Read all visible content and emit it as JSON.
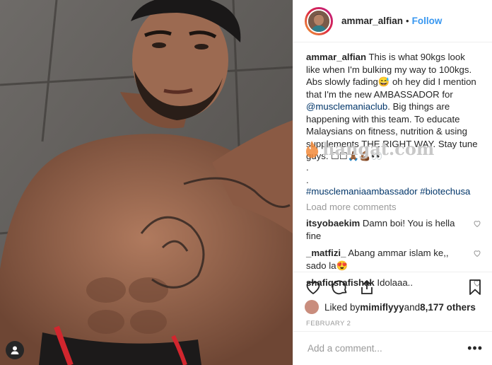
{
  "post": {
    "username": "ammar_alfian",
    "separator": "•",
    "follow_label": "Follow",
    "caption": {
      "user": "ammar_alfian",
      "p1": "This is what 90kgs look like when I'm bulking my way to 100kgs. Abs slowly fading😅 oh hey did I mention that I'm the new AMBASSADOR for ",
      "mention": "@musclemaniaclub",
      "p2": ". Big things are happening with this team. To educate Malaysians on fitness, nutrition & using supplements THE RIGHT WAY. Stay tune guys. ☐☐🙏🏾💪🏾👀",
      "dot1": ".",
      "dot2": ".",
      "hashtags": "#musclemaniaambassador #biotechusa"
    },
    "load_more": "Load more comments",
    "comments": [
      {
        "user": "itsyobaekim",
        "text": "Damn boi! You is hella fine"
      },
      {
        "user": "_matfizi_",
        "text": "Abang ammar islam ke,, sado la😍"
      },
      {
        "user": "shafiqsrafishak",
        "text": "Idolaaa.."
      }
    ],
    "likes": {
      "prefix": "Liked by ",
      "user": "mimiflyyy",
      "mid": " and ",
      "count": "8,177 others"
    },
    "date": "FEBRUARY 2",
    "add_comment_placeholder": "Add a comment...",
    "more_label": "•••"
  },
  "watermark": {
    "text": "hangat.com"
  },
  "icons": {
    "like": "heart-icon",
    "comment": "comment-icon",
    "share": "share-icon",
    "save": "bookmark-icon",
    "user_tag": "user-tag-icon"
  },
  "colors": {
    "follow": "#3897f0",
    "link": "#003569",
    "muted": "#999999",
    "border": "#efefef"
  }
}
